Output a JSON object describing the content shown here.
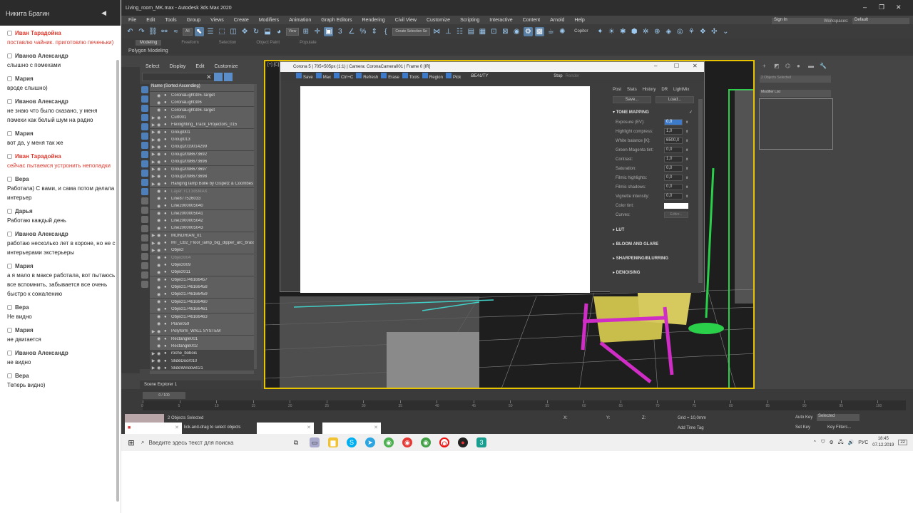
{
  "chat": {
    "header": "Никита Брагин",
    "messages": [
      {
        "name": "Иван Тарадойна",
        "text": "поставлю чайник. приготовлю печеньки)",
        "red": true
      },
      {
        "name": "Иванов Александр",
        "text": "слышно с помехами",
        "red": false
      },
      {
        "name": "Мария",
        "text": "вроде слышно)",
        "red": false
      },
      {
        "name": "Иванов Александр",
        "text": "не знаю что было сказано, у меня помехи как белый шум на радио",
        "red": false
      },
      {
        "name": "Мария",
        "text": "вот да, у меня так же",
        "red": false
      },
      {
        "name": "Иван Тарадойна",
        "text": "сейчас пытаемся устронить неполадки",
        "red": true
      },
      {
        "name": "Вера",
        "text": "Работала) С вами, и сама потом делала интерьер",
        "red": false
      },
      {
        "name": "Дарья",
        "text": "Работаю каждый день",
        "red": false
      },
      {
        "name": "Иванов Александр",
        "text": "работаю несколько лет в короне, но не с интерьерами экстерьеры",
        "red": false
      },
      {
        "name": "Мария",
        "text": "а я мало в максе работала, вот пытаюсь все вспомнить, забывается все очень быстро к сожалению",
        "red": false
      },
      {
        "name": "Вера",
        "text": "Не видно",
        "red": false
      },
      {
        "name": "Мария",
        "text": "не двигается",
        "red": false
      },
      {
        "name": "Иванов Александр",
        "text": "не видно",
        "red": false
      },
      {
        "name": "Вера",
        "text": "Теперь видно)",
        "red": false
      }
    ]
  },
  "max": {
    "title": "Living_room_MK.max - Autodesk 3ds Max 2020",
    "menu": [
      "File",
      "Edit",
      "Tools",
      "Group",
      "Views",
      "Create",
      "Modifiers",
      "Animation",
      "Graph Editors",
      "Rendering",
      "Civil View",
      "Customize",
      "Scripting",
      "Interactive",
      "Content",
      "Arnold",
      "Help"
    ],
    "signin": "Sign In",
    "workspaces_label": "Workspaces:",
    "workspaces_value": "Default",
    "toolbar_filter": "All",
    "toolbar_view": "View",
    "toolbar_selset": "Create Selection Se",
    "toolbar_copitor": "Copitor",
    "ribbon": [
      "Modeling",
      "Freeform",
      "Selection",
      "Object Paint",
      "Populate"
    ],
    "ribbon_sub": "Polygon Modeling",
    "viewport_label": "[+] [C]",
    "scene_explorer": {
      "menu": [
        "Select",
        "Display",
        "Edit",
        "Customize"
      ],
      "header": "Name (Sorted Ascending)",
      "footer": "Scene Explorer 1",
      "rows": [
        {
          "label": "CoronaLight305.Target",
          "arrow": "",
          "sel": true,
          "gray": false
        },
        {
          "label": "CoronaLight306",
          "arrow": "",
          "sel": true,
          "gray": false
        },
        {
          "label": "CoronaLight306.Target",
          "arrow": "",
          "sel": true,
          "gray": false
        },
        {
          "label": "Curt001",
          "arrow": "▶",
          "sel": true,
          "gray": false
        },
        {
          "label": "Flexlighting_Track_Projectors_015",
          "arrow": "▶",
          "sel": true,
          "gray": false
        },
        {
          "label": "Group001",
          "arrow": "▶",
          "sel": true,
          "gray": false
        },
        {
          "label": "Group013",
          "arrow": "▶",
          "sel": true,
          "gray": false
        },
        {
          "label": "Group2019014299",
          "arrow": "▶",
          "sel": true,
          "gray": false
        },
        {
          "label": "Group2098673692",
          "arrow": "▶",
          "sel": true,
          "gray": false
        },
        {
          "label": "Group2098673696",
          "arrow": "▶",
          "sel": true,
          "gray": false
        },
        {
          "label": "Group2098673697",
          "arrow": "▶",
          "sel": true,
          "gray": false
        },
        {
          "label": "Group2098673698",
          "arrow": "▶",
          "sel": true,
          "gray": false
        },
        {
          "label": "Hanging lamp Bolle by Gispetz & Coombes",
          "arrow": "▶",
          "sel": true,
          "gray": false
        },
        {
          "label": "Layer:TCI.3dsMAX",
          "arrow": "",
          "sel": true,
          "gray": true
        },
        {
          "label": "Line877526033",
          "arrow": "",
          "sel": true,
          "gray": false
        },
        {
          "label": "Line2000005040",
          "arrow": "",
          "sel": true,
          "gray": false
        },
        {
          "label": "Line2000005041",
          "arrow": "",
          "sel": true,
          "gray": false
        },
        {
          "label": "Line2000005042",
          "arrow": "",
          "sel": true,
          "gray": false
        },
        {
          "label": "Line2000005043",
          "arrow": "",
          "sel": true,
          "gray": false
        },
        {
          "label": "MONDRIAN_01",
          "arrow": "▶",
          "sel": true,
          "gray": false
        },
        {
          "label": "MT_CB2_Floor_lamp_big_dipper_arc_brass",
          "arrow": "▶",
          "sel": true,
          "gray": false
        },
        {
          "label": "Object",
          "arrow": "▶",
          "sel": true,
          "gray": false
        },
        {
          "label": "Object004",
          "arrow": "",
          "sel": true,
          "gray": true
        },
        {
          "label": "Object009",
          "arrow": "",
          "sel": true,
          "gray": false
        },
        {
          "label": "Object011",
          "arrow": "",
          "sel": true,
          "gray": false
        },
        {
          "label": "Object1746166457",
          "arrow": "",
          "sel": true,
          "gray": false
        },
        {
          "label": "Object1746166458",
          "arrow": "",
          "sel": true,
          "gray": false
        },
        {
          "label": "Object1746166459",
          "arrow": "",
          "sel": true,
          "gray": false
        },
        {
          "label": "Object1746166460",
          "arrow": "",
          "sel": true,
          "gray": false
        },
        {
          "label": "Object1746166461",
          "arrow": "",
          "sel": true,
          "gray": false
        },
        {
          "label": "Object1746166463",
          "arrow": "",
          "sel": true,
          "gray": false
        },
        {
          "label": "Plane059",
          "arrow": "",
          "sel": true,
          "gray": false
        },
        {
          "label": "Polyform_WALL SYSTEM",
          "arrow": "▶",
          "sel": true,
          "gray": false
        },
        {
          "label": "Rectangle001",
          "arrow": "",
          "sel": true,
          "gray": false
        },
        {
          "label": "Rectangle002",
          "arrow": "",
          "sel": true,
          "gray": false
        },
        {
          "label": "roche_bobois",
          "arrow": "▶",
          "sel": false,
          "gray": false
        },
        {
          "label": "SlideDoor010",
          "arrow": "▶",
          "sel": false,
          "gray": false
        },
        {
          "label": "SlideWindow021",
          "arrow": "▶",
          "sel": false,
          "gray": false
        }
      ]
    },
    "render": {
      "title": "Corona 5 | 705×505px (1:1) | Camera: CoronaCamera001 | Frame 0 [IR]",
      "toolbar": [
        "Save",
        "Max",
        "Ctrl+C",
        "Refresh",
        "Erase",
        "Tools",
        "Region",
        "Pick"
      ],
      "beauty": "BEAUTY",
      "stop": "Stop",
      "render_btn": "Render",
      "tabs": [
        "Post",
        "Stats",
        "History",
        "DR",
        "LightMix"
      ],
      "save_btn": "Save...",
      "load_btn": "Load...",
      "section_tone": "TONE MAPPING",
      "params": [
        {
          "label": "Exposure (EV):",
          "value": "0,0",
          "hl": true
        },
        {
          "label": "Highlight compress:",
          "value": "1,0",
          "hl": false
        },
        {
          "label": "White balance [K]:",
          "value": "6500,0",
          "hl": false
        },
        {
          "label": "Green-Magenta tint:",
          "value": "0,0",
          "hl": false
        },
        {
          "label": "Contrast:",
          "value": "1,0",
          "hl": false
        },
        {
          "label": "Saturation:",
          "value": "0,0",
          "hl": false
        },
        {
          "label": "Filmic highlights:",
          "value": "0,0",
          "hl": false
        },
        {
          "label": "Filmic shadows:",
          "value": "0,0",
          "hl": false
        },
        {
          "label": "Vignette intensity:",
          "value": "0,0",
          "hl": false
        }
      ],
      "color_tint": "Color tint:",
      "curves": "Curves:",
      "curves_btn": "Editor...",
      "sections": [
        "LUT",
        "BLOOM AND GLARE",
        "SHARPENING/BLURRING",
        "DENOISING"
      ]
    },
    "right_panel": {
      "selection": "2 Objects Selected",
      "modifier_list": "Modifier List"
    },
    "timeline": {
      "counter": "0 / 100",
      "ticks": [
        "0",
        "5",
        "10",
        "15",
        "20",
        "25",
        "30",
        "35",
        "40",
        "45",
        "50",
        "55",
        "60",
        "65",
        "70",
        "75",
        "80",
        "85",
        "90",
        "95",
        "100"
      ]
    },
    "status": {
      "selected": "2 Objects Selected",
      "hint": "lick-and-drag to select objects",
      "x": "X:",
      "y": "Y:",
      "z": "Z:",
      "grid": "Grid = 10,0mm",
      "add_time_tag": "Add Time Tag",
      "auto_key": "Auto Key",
      "selected_dd": "Selected",
      "set_key": "Set Key",
      "key_filters": "Key Filters..."
    }
  },
  "taskbar": {
    "search": "Введите здесь текст для поиска",
    "lang": "РУС",
    "time": "18:45",
    "date": "07.12.2019",
    "notif": "22"
  }
}
